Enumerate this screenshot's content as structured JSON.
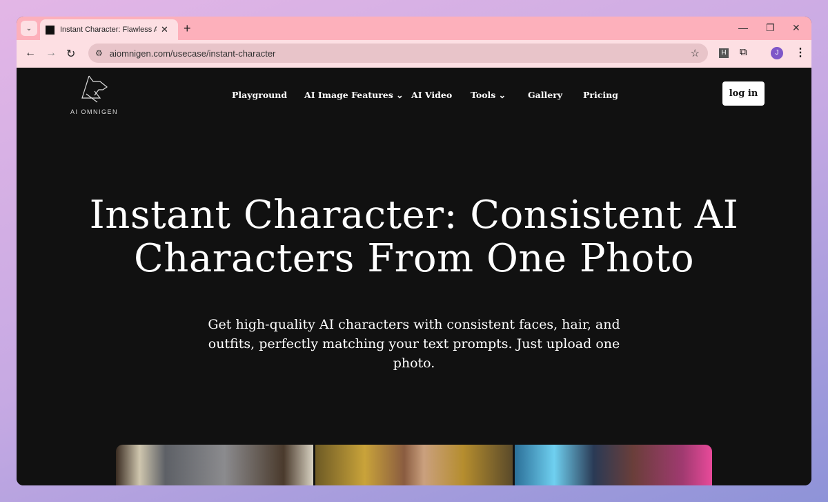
{
  "browser": {
    "tab_title": "Instant Character: Flawless AI Characters",
    "url": "aiomnigen.com/usecase/instant-character",
    "profile_initial": "J",
    "extension_label": "H"
  },
  "site": {
    "logo_text": "AI OMNIGEN",
    "nav": [
      {
        "label": "Playground"
      },
      {
        "label": "AI Image Features ⌄"
      },
      {
        "label": "AI Video"
      },
      {
        "label": "Tools ⌄"
      },
      {
        "label": "Gallery"
      },
      {
        "label": "Pricing"
      }
    ],
    "login_label": "log in"
  },
  "hero": {
    "title": "Instant Character: Consistent AI Characters From One Photo",
    "subtitle": "Get high-quality AI characters with consistent faces, hair, and outfits, perfectly matching your text prompts. Just upload one photo."
  },
  "colors": {
    "page_bg": "#111111",
    "tab_bar": "#fdb0bb",
    "toolbar": "#fddfe3",
    "avatar": "#7e56c8"
  }
}
